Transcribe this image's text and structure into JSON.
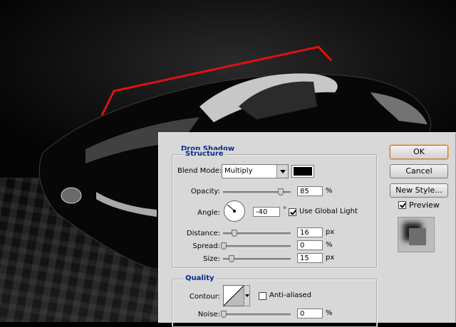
{
  "background": {
    "line_color": "#e01010"
  },
  "dialog": {
    "section_title": "Drop Shadow",
    "structure": {
      "title": "Structure",
      "blend_mode_label": "Blend Mode:",
      "blend_mode_value": "Multiply",
      "shadow_color": "#000000",
      "opacity_label": "Opacity:",
      "opacity_value": "85",
      "opacity_unit": "%",
      "opacity_level": 0.85,
      "angle_label": "Angle:",
      "angle_value": "-40",
      "angle_unit": "°",
      "use_global_light_label": "Use Global Light",
      "use_global_light_checked": true,
      "distance_label": "Distance:",
      "distance_value": "16",
      "distance_unit": "px",
      "spread_label": "Spread:",
      "spread_value": "0",
      "spread_unit": "%",
      "size_label": "Size:",
      "size_value": "15",
      "size_unit": "px"
    },
    "quality": {
      "title": "Quality",
      "contour_label": "Contour:",
      "anti_aliased_label": "Anti-aliased",
      "anti_aliased_checked": false,
      "noise_label": "Noise:",
      "noise_value": "0",
      "noise_unit": "%"
    },
    "buttons": {
      "ok": "OK",
      "cancel": "Cancel",
      "new_style": "New Style..."
    },
    "preview": {
      "label": "Preview",
      "checked": true
    }
  }
}
